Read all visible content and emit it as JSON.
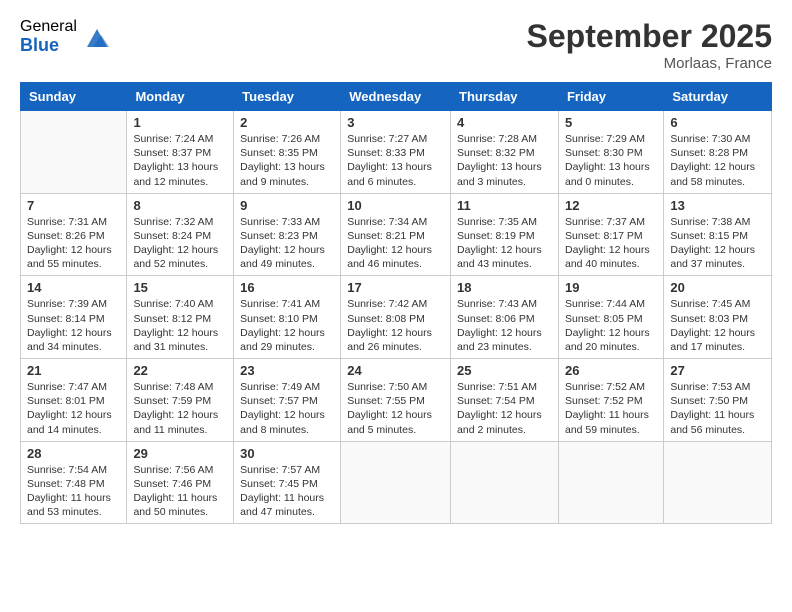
{
  "header": {
    "logo_general": "General",
    "logo_blue": "Blue",
    "month_title": "September 2025",
    "location": "Morlaas, France"
  },
  "days_of_week": [
    "Sunday",
    "Monday",
    "Tuesday",
    "Wednesday",
    "Thursday",
    "Friday",
    "Saturday"
  ],
  "weeks": [
    [
      {
        "day": "",
        "info": ""
      },
      {
        "day": "1",
        "info": "Sunrise: 7:24 AM\nSunset: 8:37 PM\nDaylight: 13 hours\nand 12 minutes."
      },
      {
        "day": "2",
        "info": "Sunrise: 7:26 AM\nSunset: 8:35 PM\nDaylight: 13 hours\nand 9 minutes."
      },
      {
        "day": "3",
        "info": "Sunrise: 7:27 AM\nSunset: 8:33 PM\nDaylight: 13 hours\nand 6 minutes."
      },
      {
        "day": "4",
        "info": "Sunrise: 7:28 AM\nSunset: 8:32 PM\nDaylight: 13 hours\nand 3 minutes."
      },
      {
        "day": "5",
        "info": "Sunrise: 7:29 AM\nSunset: 8:30 PM\nDaylight: 13 hours\nand 0 minutes."
      },
      {
        "day": "6",
        "info": "Sunrise: 7:30 AM\nSunset: 8:28 PM\nDaylight: 12 hours\nand 58 minutes."
      }
    ],
    [
      {
        "day": "7",
        "info": "Sunrise: 7:31 AM\nSunset: 8:26 PM\nDaylight: 12 hours\nand 55 minutes."
      },
      {
        "day": "8",
        "info": "Sunrise: 7:32 AM\nSunset: 8:24 PM\nDaylight: 12 hours\nand 52 minutes."
      },
      {
        "day": "9",
        "info": "Sunrise: 7:33 AM\nSunset: 8:23 PM\nDaylight: 12 hours\nand 49 minutes."
      },
      {
        "day": "10",
        "info": "Sunrise: 7:34 AM\nSunset: 8:21 PM\nDaylight: 12 hours\nand 46 minutes."
      },
      {
        "day": "11",
        "info": "Sunrise: 7:35 AM\nSunset: 8:19 PM\nDaylight: 12 hours\nand 43 minutes."
      },
      {
        "day": "12",
        "info": "Sunrise: 7:37 AM\nSunset: 8:17 PM\nDaylight: 12 hours\nand 40 minutes."
      },
      {
        "day": "13",
        "info": "Sunrise: 7:38 AM\nSunset: 8:15 PM\nDaylight: 12 hours\nand 37 minutes."
      }
    ],
    [
      {
        "day": "14",
        "info": "Sunrise: 7:39 AM\nSunset: 8:14 PM\nDaylight: 12 hours\nand 34 minutes."
      },
      {
        "day": "15",
        "info": "Sunrise: 7:40 AM\nSunset: 8:12 PM\nDaylight: 12 hours\nand 31 minutes."
      },
      {
        "day": "16",
        "info": "Sunrise: 7:41 AM\nSunset: 8:10 PM\nDaylight: 12 hours\nand 29 minutes."
      },
      {
        "day": "17",
        "info": "Sunrise: 7:42 AM\nSunset: 8:08 PM\nDaylight: 12 hours\nand 26 minutes."
      },
      {
        "day": "18",
        "info": "Sunrise: 7:43 AM\nSunset: 8:06 PM\nDaylight: 12 hours\nand 23 minutes."
      },
      {
        "day": "19",
        "info": "Sunrise: 7:44 AM\nSunset: 8:05 PM\nDaylight: 12 hours\nand 20 minutes."
      },
      {
        "day": "20",
        "info": "Sunrise: 7:45 AM\nSunset: 8:03 PM\nDaylight: 12 hours\nand 17 minutes."
      }
    ],
    [
      {
        "day": "21",
        "info": "Sunrise: 7:47 AM\nSunset: 8:01 PM\nDaylight: 12 hours\nand 14 minutes."
      },
      {
        "day": "22",
        "info": "Sunrise: 7:48 AM\nSunset: 7:59 PM\nDaylight: 12 hours\nand 11 minutes."
      },
      {
        "day": "23",
        "info": "Sunrise: 7:49 AM\nSunset: 7:57 PM\nDaylight: 12 hours\nand 8 minutes."
      },
      {
        "day": "24",
        "info": "Sunrise: 7:50 AM\nSunset: 7:55 PM\nDaylight: 12 hours\nand 5 minutes."
      },
      {
        "day": "25",
        "info": "Sunrise: 7:51 AM\nSunset: 7:54 PM\nDaylight: 12 hours\nand 2 minutes."
      },
      {
        "day": "26",
        "info": "Sunrise: 7:52 AM\nSunset: 7:52 PM\nDaylight: 11 hours\nand 59 minutes."
      },
      {
        "day": "27",
        "info": "Sunrise: 7:53 AM\nSunset: 7:50 PM\nDaylight: 11 hours\nand 56 minutes."
      }
    ],
    [
      {
        "day": "28",
        "info": "Sunrise: 7:54 AM\nSunset: 7:48 PM\nDaylight: 11 hours\nand 53 minutes."
      },
      {
        "day": "29",
        "info": "Sunrise: 7:56 AM\nSunset: 7:46 PM\nDaylight: 11 hours\nand 50 minutes."
      },
      {
        "day": "30",
        "info": "Sunrise: 7:57 AM\nSunset: 7:45 PM\nDaylight: 11 hours\nand 47 minutes."
      },
      {
        "day": "",
        "info": ""
      },
      {
        "day": "",
        "info": ""
      },
      {
        "day": "",
        "info": ""
      },
      {
        "day": "",
        "info": ""
      }
    ]
  ]
}
